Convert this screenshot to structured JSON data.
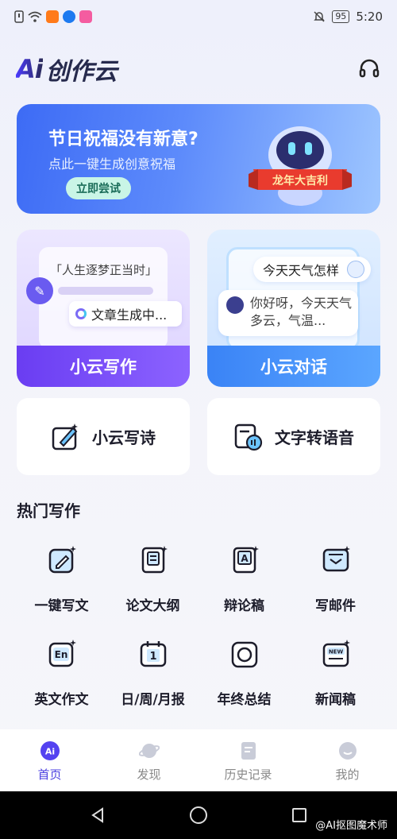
{
  "status_bar": {
    "battery": "95",
    "time": "5:20"
  },
  "header": {
    "logo_ai": "Ai",
    "logo_text": "创作云",
    "headset_icon": "headset-icon"
  },
  "banner": {
    "title": "节日祝福没有新意?",
    "subtitle": "点此一键生成创意祝福",
    "button": "立即尝试",
    "ribbon": "龙年大吉利"
  },
  "features": {
    "write": {
      "quote": "「人生逐梦正当时」",
      "status": "文章生成中...",
      "label": "小云写作"
    },
    "chat": {
      "question": "今天天气怎样",
      "answer_line1": "你好呀，今天天气",
      "answer_line2": "多云，气温...",
      "label": "小云对话"
    },
    "poem": {
      "label": "小云写诗"
    },
    "tts": {
      "label": "文字转语音"
    }
  },
  "hot_section": {
    "title": "热门写作",
    "items": [
      {
        "label": "一键写文",
        "icon": "edit-icon"
      },
      {
        "label": "论文大纲",
        "icon": "book-icon"
      },
      {
        "label": "辩论稿",
        "icon": "document-a-icon"
      },
      {
        "label": "写邮件",
        "icon": "mail-icon"
      },
      {
        "label": "英文作文",
        "icon": "en-icon"
      },
      {
        "label": "日/周/月报",
        "icon": "calendar-icon"
      },
      {
        "label": "年终总结",
        "icon": "circle-icon"
      },
      {
        "label": "新闻稿",
        "icon": "news-icon"
      }
    ]
  },
  "bottom_nav": {
    "items": [
      {
        "label": "首页",
        "icon": "home-ai-icon"
      },
      {
        "label": "发现",
        "icon": "planet-icon"
      },
      {
        "label": "历史记录",
        "icon": "history-icon"
      },
      {
        "label": "我的",
        "icon": "profile-icon"
      }
    ]
  },
  "watermark": "@AI抠图魔术师",
  "colors": {
    "accent": "#4b3fe0",
    "banner_blue": "#3d6bf5",
    "write_purple": "#6a3df2",
    "chat_blue": "#3a83f6"
  }
}
